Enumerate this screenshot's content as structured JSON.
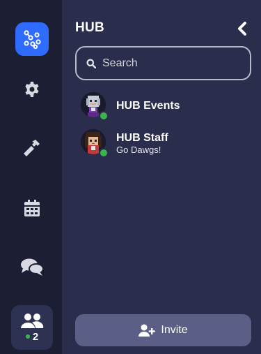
{
  "sidebar": {
    "items": [
      {
        "icon": "network-logo-icon"
      },
      {
        "icon": "gear-icon"
      },
      {
        "icon": "hammer-icon"
      },
      {
        "icon": "calendar-icon"
      },
      {
        "icon": "chat-bubbles-icon"
      }
    ],
    "users": {
      "icon": "users-icon",
      "count": "2"
    }
  },
  "panel": {
    "title": "HUB",
    "collapse_icon": "chevron-left-icon",
    "search": {
      "placeholder": "Search",
      "value": ""
    },
    "channels": [
      {
        "name": "HUB Events",
        "subtitle": "",
        "status": "online"
      },
      {
        "name": "HUB Staff",
        "subtitle": "Go Dawgs!",
        "status": "online"
      }
    ],
    "invite_label": "Invite"
  },
  "colors": {
    "sidebar_bg": "#1c1e33",
    "panel_bg": "#2a2d4b",
    "accent": "#2f6bff",
    "online": "#3ab54a",
    "invite_bg": "#5b5f86"
  }
}
